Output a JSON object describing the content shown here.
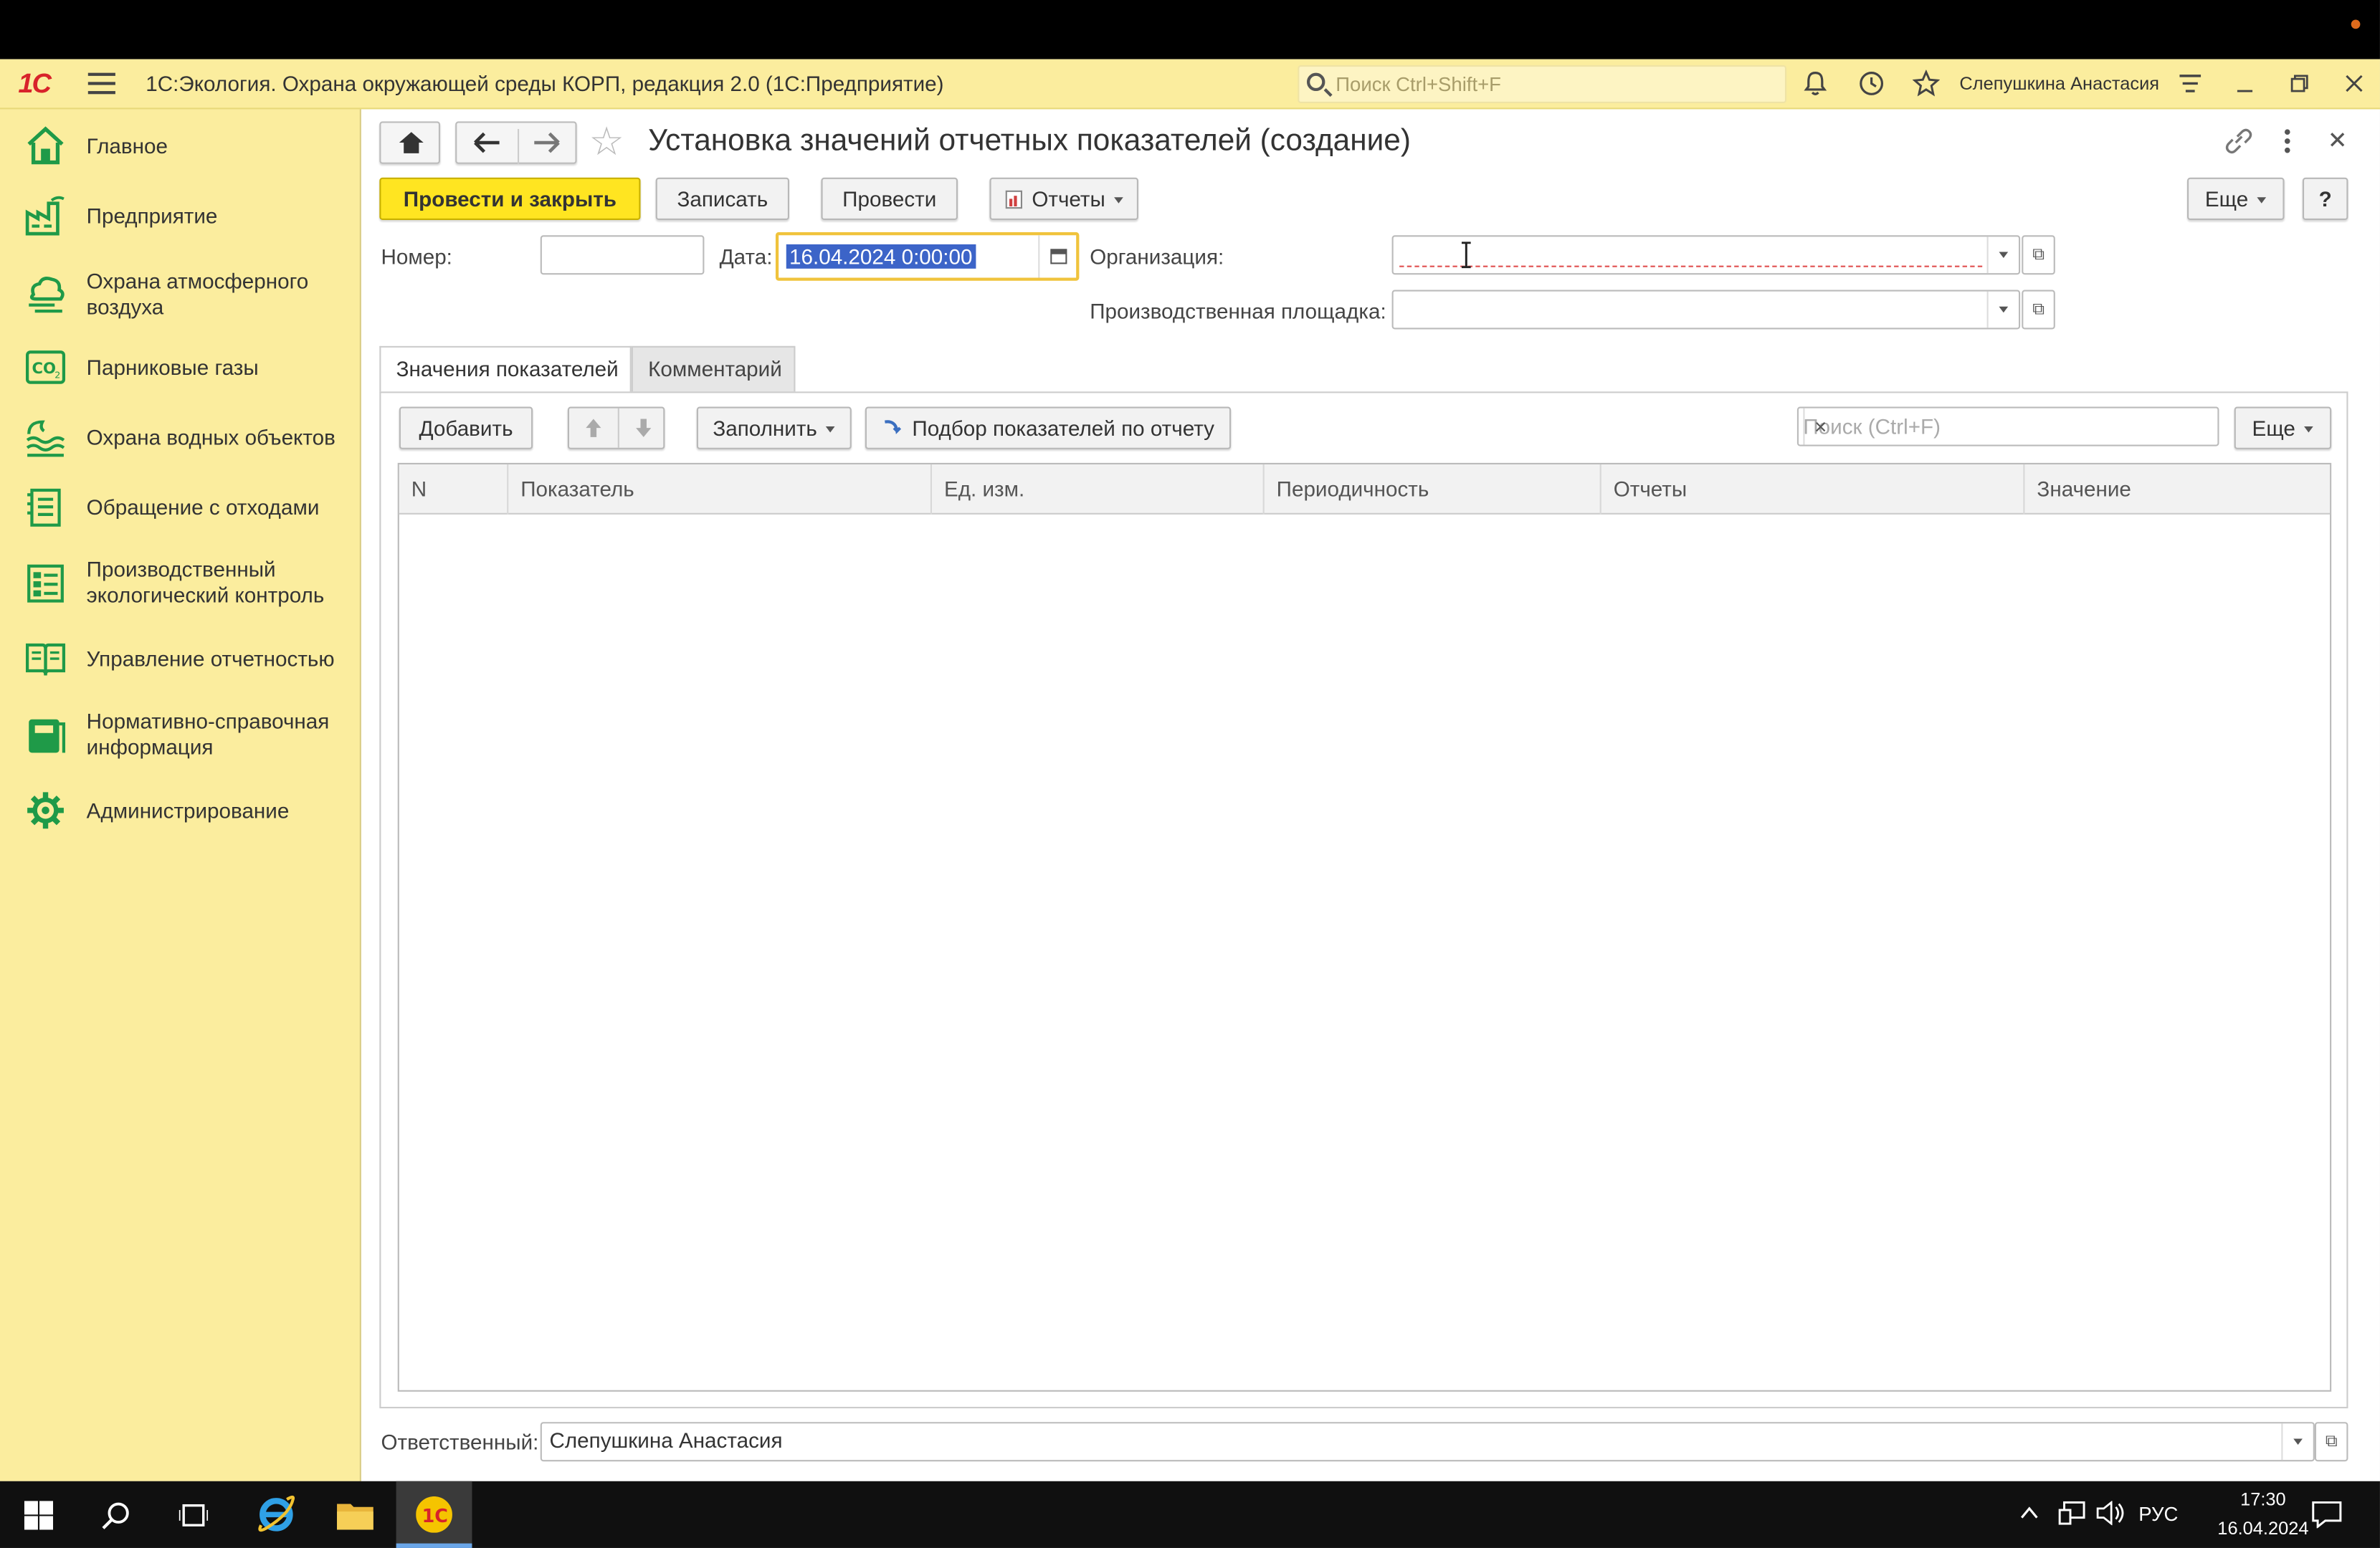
{
  "app": {
    "title": "1С:Экология. Охрана окружающей среды КОРП, редакция 2.0  (1С:Предприятие)",
    "logo": "1С",
    "search_placeholder": "Поиск Ctrl+Shift+F",
    "user": "Слепушкина Анастасия"
  },
  "sidebar": {
    "items": [
      {
        "label": "Главное",
        "icon": "home-icon"
      },
      {
        "label": "Предприятие",
        "icon": "factory-icon"
      },
      {
        "label": "Охрана атмосферного воздуха",
        "icon": "air-cloud-icon"
      },
      {
        "label": "Парниковые газы",
        "icon": "co2-icon"
      },
      {
        "label": "Охрана водных объектов",
        "icon": "water-icon"
      },
      {
        "label": "Обращение с отходами",
        "icon": "waste-icon"
      },
      {
        "label": "Производственный экологический контроль",
        "icon": "control-icon"
      },
      {
        "label": "Управление отчетностью",
        "icon": "report-book-icon"
      },
      {
        "label": "Нормативно-справочная информация",
        "icon": "reference-book-icon"
      },
      {
        "label": "Администрирование",
        "icon": "gear-icon"
      }
    ]
  },
  "document": {
    "title": "Установка значений отчетных показателей (создание)",
    "buttons": {
      "post_close": "Провести и закрыть",
      "save": "Записать",
      "post": "Провести",
      "reports": "Отчеты",
      "more": "Еще",
      "help": "?"
    },
    "fields": {
      "number_label": "Номер:",
      "number_value": "",
      "date_label": "Дата:",
      "date_value": "16.04.2024  0:00:00",
      "org_label": "Организация:",
      "org_value": "",
      "site_label": "Производственная площадка:",
      "site_value": ""
    },
    "tabs": [
      {
        "label": "Значения показателей",
        "active": true
      },
      {
        "label": "Комментарий",
        "active": false
      }
    ],
    "table_toolbar": {
      "add": "Добавить",
      "fill": "Заполнить",
      "pick": "Подбор показателей по отчету",
      "search_placeholder": "Поиск (Ctrl+F)",
      "more": "Еще"
    },
    "table": {
      "columns": [
        "N",
        "Показатель",
        "Ед. изм.",
        "Периодичность",
        "Отчеты",
        "Значение"
      ],
      "rows": []
    },
    "responsible_label": "Ответственный:",
    "responsible_value": "Слепушкина Анастасия"
  },
  "taskbar": {
    "lang": "РУС",
    "time": "17:30",
    "date": "16.04.2024"
  }
}
